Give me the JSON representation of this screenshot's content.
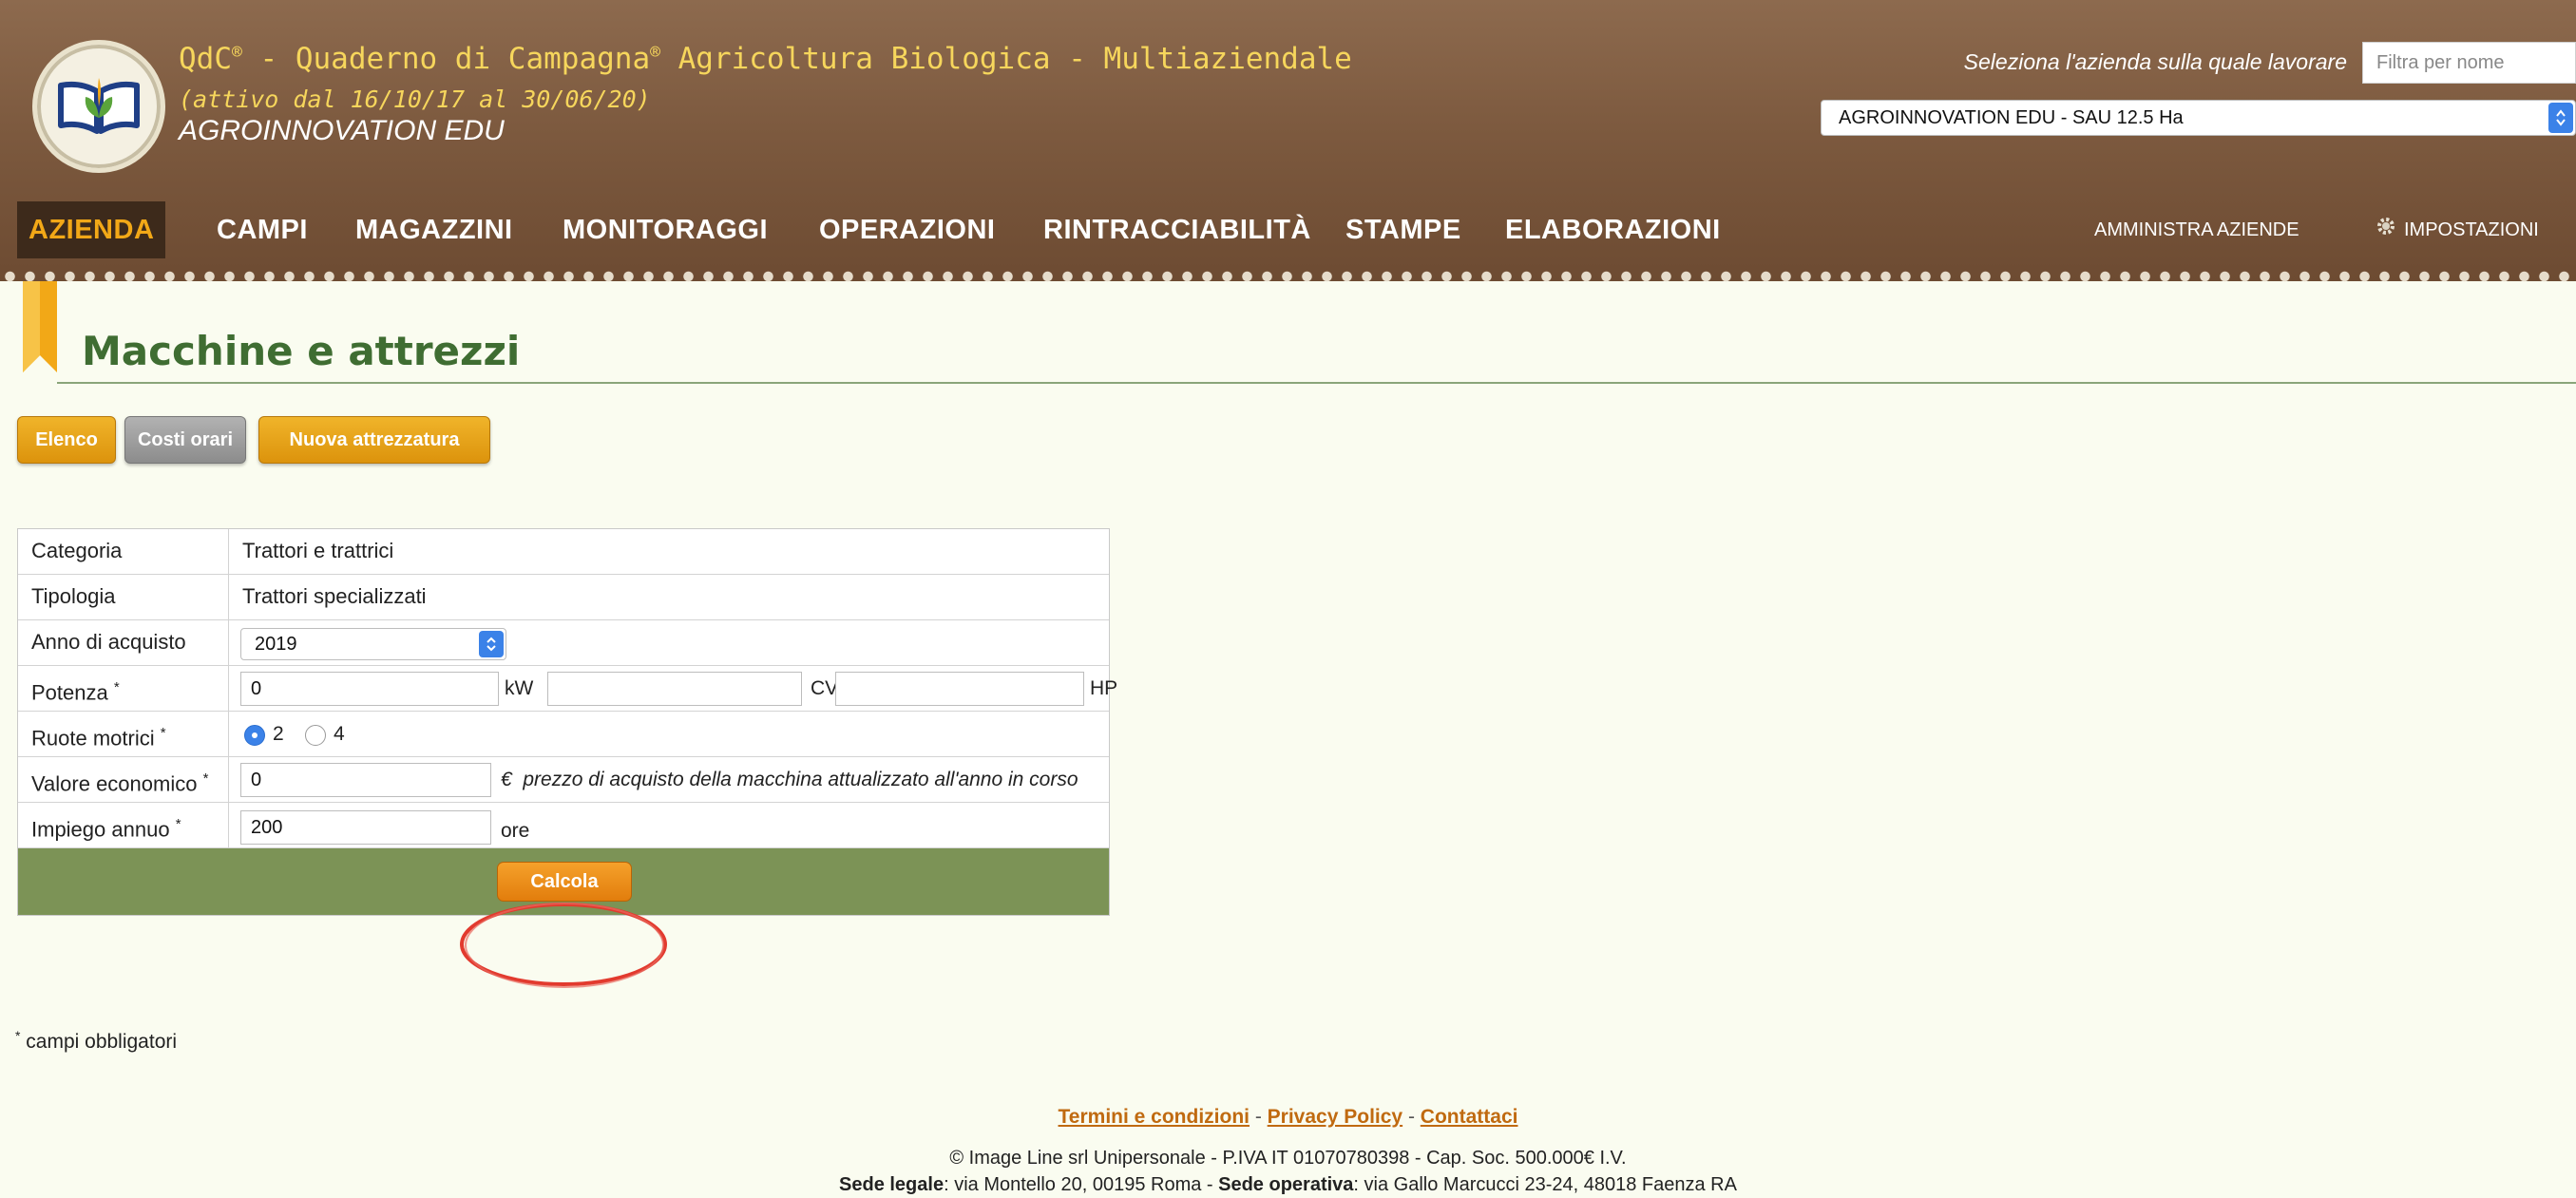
{
  "header": {
    "app_title": "QdC",
    "title_part2": " - Quaderno di Campagna",
    "title_part3": " Agricoltura Biologica - Multiaziendale",
    "registered_mark": "®",
    "subtitle": "(attivo dal 16/10/17 al 30/06/20)",
    "company": "AGROINNOVATION EDU",
    "select_company_label": "Seleziona l'azienda sulla quale lavorare",
    "filter_placeholder": "Filtra per nome",
    "company_select_value": "AGROINNOVATION EDU - SAU 12.5 Ha",
    "logo_icon": "leaf-book-icon",
    "colors": {
      "header_bg": "#7d5a3f",
      "title_yellow": "#f6d65c",
      "active_orange": "#f2a817"
    }
  },
  "nav": {
    "items": [
      {
        "label": "AZIENDA",
        "active": true
      },
      {
        "label": "CAMPI"
      },
      {
        "label": "MAGAZZINI"
      },
      {
        "label": "MONITORAGGI"
      },
      {
        "label": "OPERAZIONI"
      },
      {
        "label": "RINTRACCIABILITÀ"
      },
      {
        "label": "STAMPE"
      },
      {
        "label": "ELABORAZIONI"
      }
    ],
    "admin_label": "AMMINISTRA AZIENDE",
    "settings_label": "IMPOSTAZIONI",
    "settings_icon": "gear-icon"
  },
  "page": {
    "title": "Macchine e attrezzi",
    "title_color": "#3f6d32"
  },
  "tabs": [
    {
      "label": "Elenco"
    },
    {
      "label": "Costi orari"
    },
    {
      "label": "Nuova attrezzatura"
    }
  ],
  "form": {
    "categoria": {
      "label": "Categoria",
      "value": "Trattori e trattrici"
    },
    "tipologia": {
      "label": "Tipologia",
      "value": "Trattori specializzati"
    },
    "anno": {
      "label": "Anno di acquisto",
      "value": "2019"
    },
    "potenza": {
      "label": "Potenza",
      "required_mark": "*",
      "kw_value": "0",
      "kw_unit": "kW",
      "cv_value": "",
      "cv_unit": "CV",
      "hp_value": "",
      "hp_unit": "HP"
    },
    "ruote": {
      "label": "Ruote motrici",
      "required_mark": "*",
      "options": [
        "2",
        "4"
      ],
      "selected": "2"
    },
    "valore": {
      "label": "Valore economico",
      "required_mark": "*",
      "value": "0",
      "currency": "€",
      "hint": "prezzo di acquisto della macchina attualizzato all'anno in corso"
    },
    "impiego": {
      "label": "Impiego annuo",
      "required_mark": "*",
      "value": "200",
      "unit": "ore"
    },
    "submit_label": "Calcola",
    "action_bar_color": "#7c9356"
  },
  "footer": {
    "mandatory_mark": "*",
    "mandatory_note": " campi obbligatori",
    "links": {
      "terms": "Termini e condizioni",
      "privacy": "Privacy Policy",
      "contact": "Contattaci",
      "separator": " - "
    },
    "copyright": "© Image Line srl Unipersonale - P.IVA IT 01070780398 - Cap. Soc. 500.000€ I.V.",
    "address": {
      "legal_label": "Sede legale",
      "legal_value": ": via Montello 20, 00195 Roma - ",
      "operative_label": "Sede operativa",
      "operative_value": ": via Gallo Marcucci 23-24, 48018 Faenza RA"
    }
  }
}
